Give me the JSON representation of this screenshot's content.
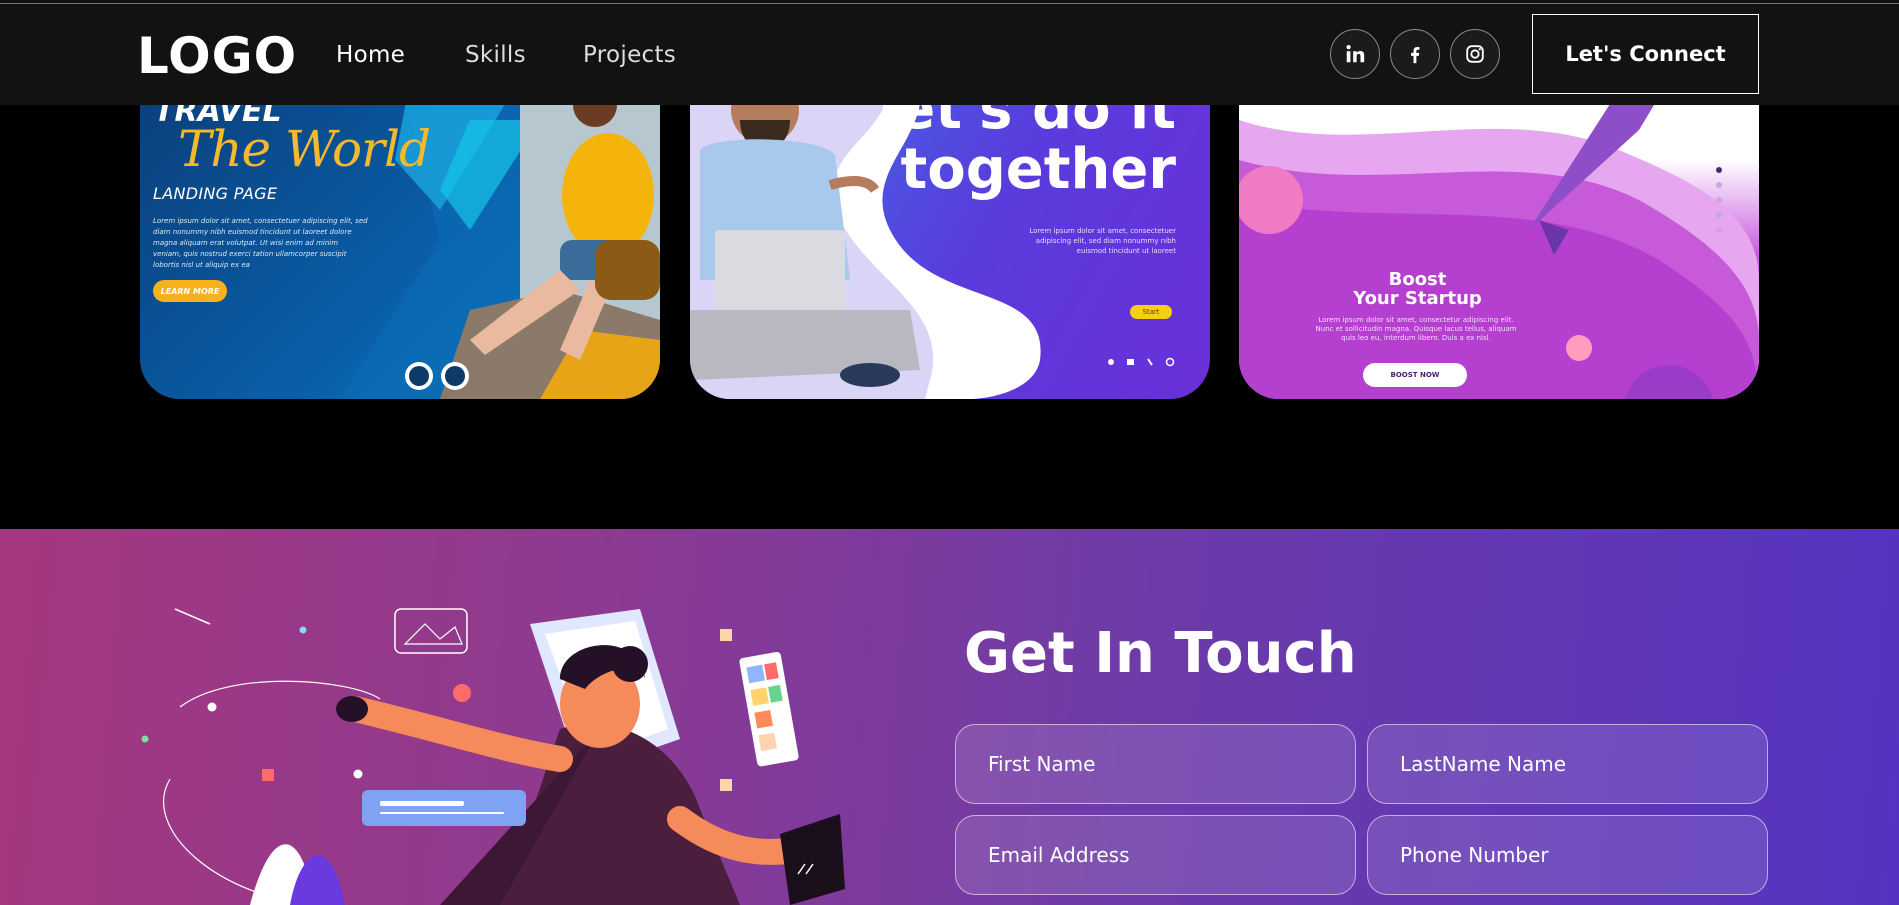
{
  "nav": {
    "logo": "LOGO",
    "links": [
      "Home",
      "Skills",
      "Projects"
    ],
    "social": [
      "linkedin-icon",
      "facebook-icon",
      "instagram-icon"
    ],
    "cta": "Let's Connect"
  },
  "projects": {
    "card1": {
      "heading_top": "TRAVEL",
      "heading_script": "The World",
      "subtitle": "LANDING PAGE",
      "body": "Lorem ipsum dolor sit amet, consectetuer adipiscing elit, sed diam nonummy nibh euismod tincidunt ut laoreet dolore magna aliquam erat volutpat. Ut wisi enim ad minim veniam, quis nostrud exerci tation ullamcorper suscipit lobortis nisl ut aliquip ex ea",
      "button": "LEARN MORE"
    },
    "card2": {
      "line1": "let's do it",
      "line2": "together",
      "body": "Lorem ipsum dolor sit amet, consectetuer adipiscing elit, sed diam nonummy nibh euismod tincidunt ut laoreet",
      "button": "Start"
    },
    "card3": {
      "line1": "Boost",
      "line2": "Your Startup",
      "body": "Lorem ipsum dolor sit amet, consectetur adipiscing elit. Nunc et sollicitudin magna. Quisque lacus tellus, aliquam quis leo eu, interdum libero. Duis a ex nisl.",
      "button": "BOOST NOW"
    }
  },
  "contact": {
    "title": "Get In Touch",
    "fields": {
      "first": "First Name",
      "last": "LastName Name",
      "email": "Email Address",
      "phone": "Phone Number"
    }
  },
  "colors": {
    "navbar": "#121212",
    "contact_gradient_start": "#a4377f",
    "contact_gradient_end": "#5533c0"
  }
}
